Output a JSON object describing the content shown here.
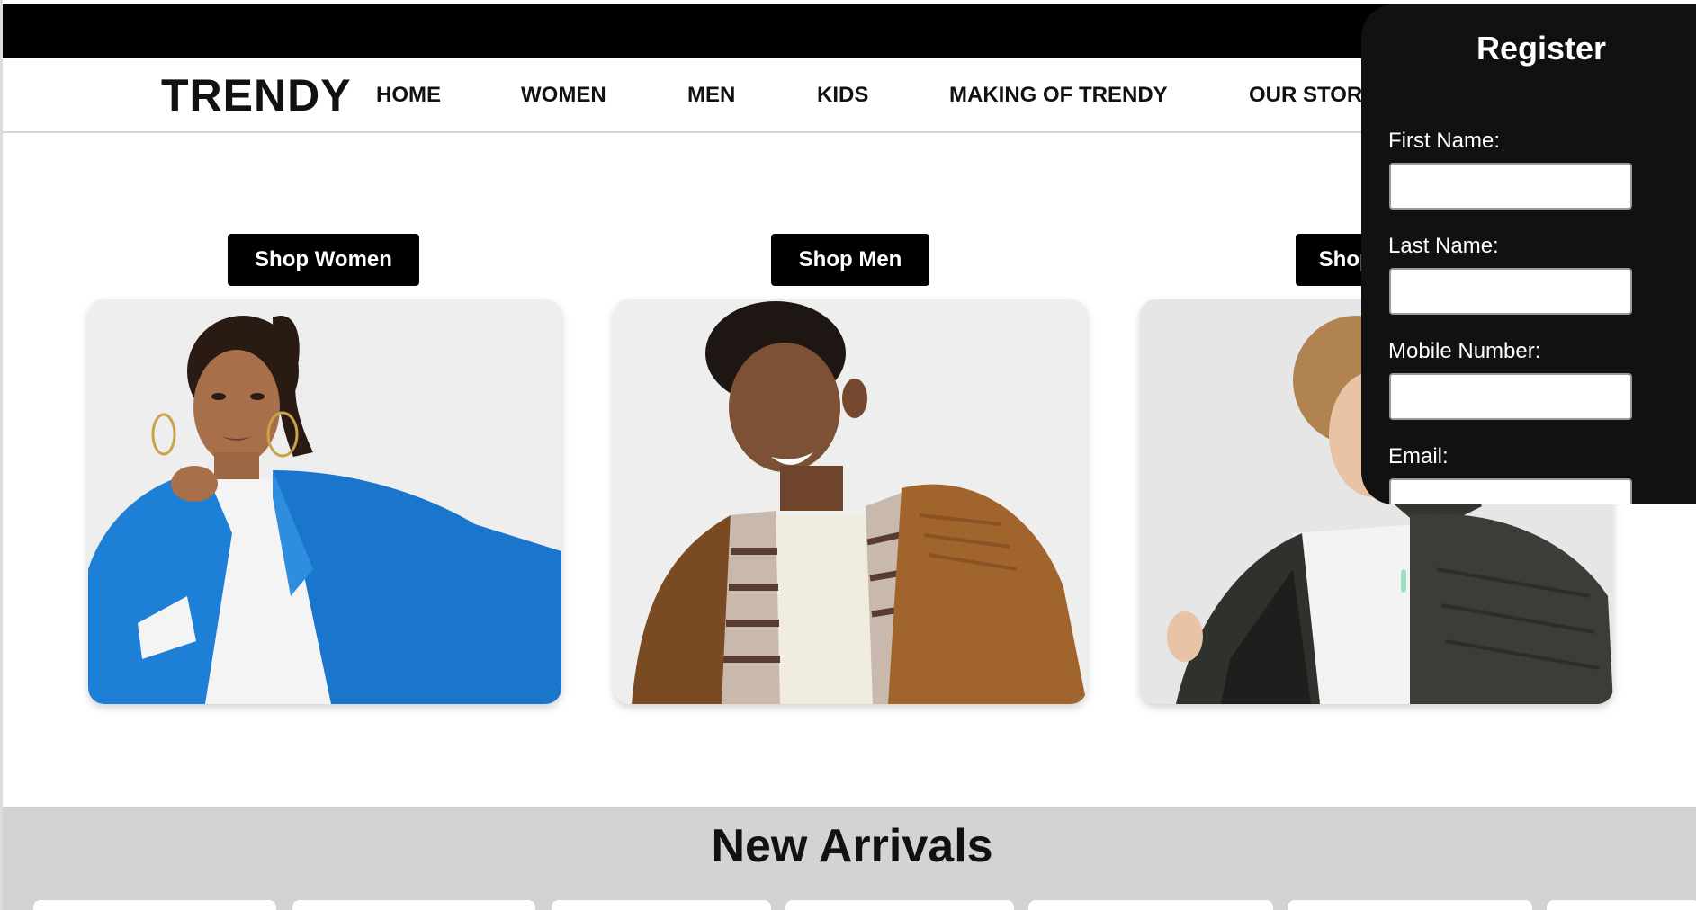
{
  "brand": {
    "name": "TRENDY"
  },
  "nav": {
    "home": "HOME",
    "women": "WOMEN",
    "men": "MEN",
    "kids": "KIDS",
    "making": "MAKING OF TRENDY",
    "story": "OUR STORY"
  },
  "shop": {
    "women_label": "Shop Women",
    "men_label": "Shop Men",
    "kids_label": "Shop Kids"
  },
  "arrivals": {
    "title": "New Arrivals"
  },
  "register": {
    "title": "Register",
    "first_name_label": "First Name:",
    "last_name_label": "Last Name:",
    "mobile_label": "Mobile Number:",
    "email_label": "Email:",
    "first_name_value": "",
    "last_name_value": "",
    "mobile_value": "",
    "email_value": ""
  },
  "colors": {
    "topbar": "#000000",
    "register_bg": "#111111",
    "arrivals_bg": "#d3d3d3",
    "women_coat": "#1e7fd6",
    "men_jacket": "#a2642d",
    "kids_jacket": "#3b3d38"
  }
}
